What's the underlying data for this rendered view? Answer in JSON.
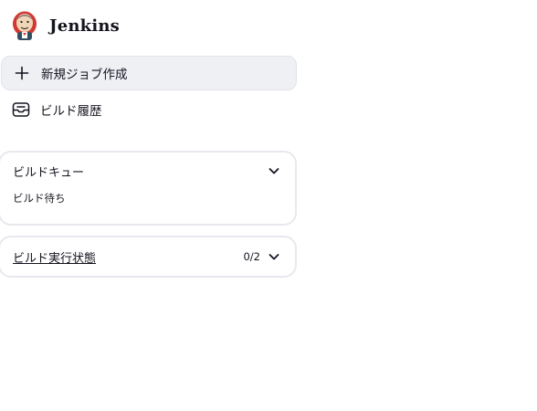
{
  "header": {
    "brand": "Jenkins",
    "logo_icon": "jenkins-logo"
  },
  "nav": {
    "items": [
      {
        "label": "新規ジョブ作成",
        "icon": "plus-icon",
        "active": true
      },
      {
        "label": "ビルド履歴",
        "icon": "inbox-icon",
        "active": false
      }
    ]
  },
  "build_queue": {
    "title": "ビルドキュー",
    "empty_text": "ビルド待ち",
    "expanded": true
  },
  "executors": {
    "title": "ビルド実行状態",
    "count": "0/2"
  },
  "colors": {
    "active_bg": "#eef0f4",
    "card_border": "#e8e9ee",
    "text": "#14141f"
  }
}
